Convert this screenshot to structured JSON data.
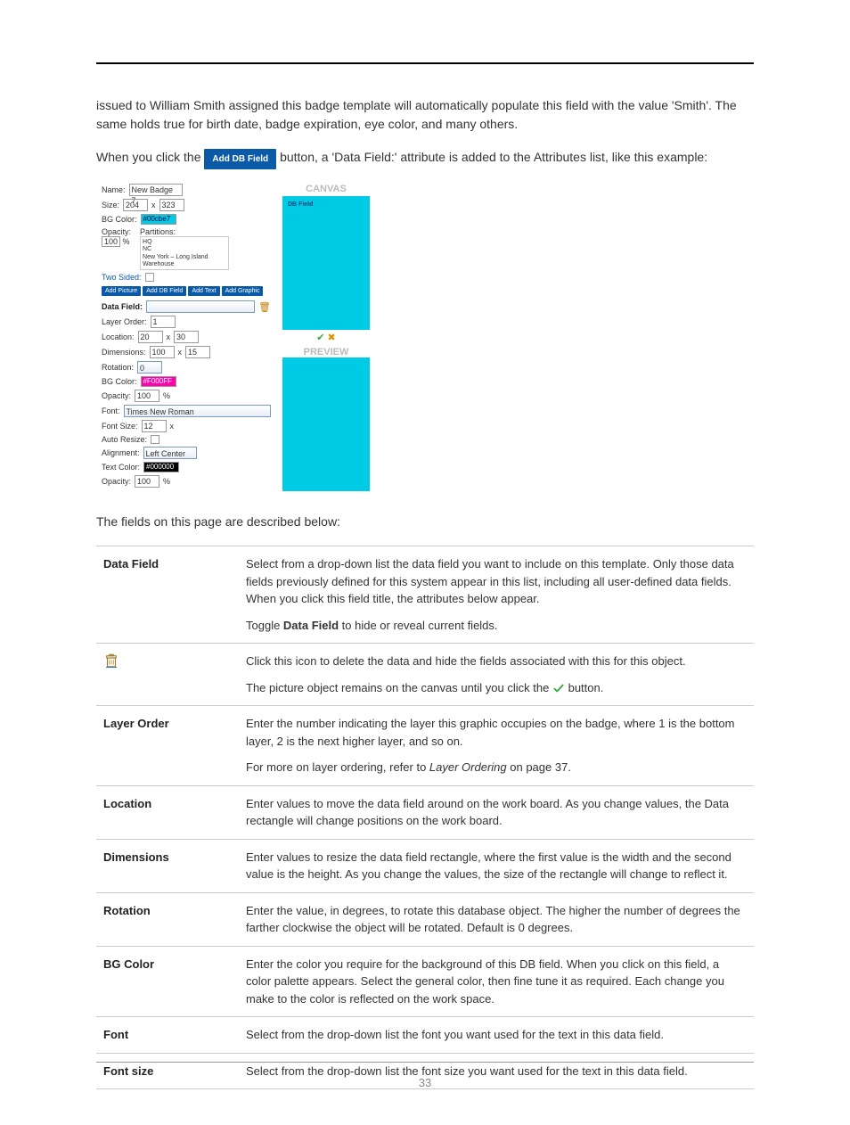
{
  "intro": {
    "p1": "issued to William Smith assigned this badge template will automatically populate this field with the value 'Smith'. The same holds true for birth date, badge expiration, eye color, and many others.",
    "p2a": "When you click the ",
    "p2btn": "Add DB Field",
    "p2b": " button, a 'Data Field:' attribute is added to the Attributes list, like this example:"
  },
  "figure": {
    "name_label": "Name:",
    "name_value": "New Badge 7",
    "size_label": "Size:",
    "size1": "204",
    "size2": "323",
    "bgcolor_label": "BG Color:",
    "bgcolor_value": "#00cbe7",
    "opacity_label": "Opacity:",
    "opacity_value": "100",
    "pct": "%",
    "partitions_label": "Partitions:",
    "partitions_items": [
      "HQ",
      "NC",
      "New York – Long Island Warehouse"
    ],
    "twosided": "Two Sided:",
    "buttons": [
      "Add Picture",
      "Add DB Field",
      "Add Text",
      "Add Graphic"
    ],
    "datafield_label": "Data Field:",
    "layer_label": "Layer Order:",
    "layer_value": "1",
    "location_label": "Location:",
    "location_x": "20",
    "location_y": "30",
    "dimensions_label": "Dimensions:",
    "dim_w": "100",
    "dim_h": "15",
    "rotation_label": "Rotation:",
    "rotation_value": "0",
    "bg2_label": "BG Color:",
    "bg2_value": "#F000FF",
    "opacity2_label": "Opacity:",
    "opacity2_value": "100",
    "font_label": "Font:",
    "font_value": "Times New Roman",
    "fontsize_label": "Font Size:",
    "fontsize_value": "12",
    "autoresize_label": "Auto Resize:",
    "alignment_label": "Alignment:",
    "alignment_value": "Left Center",
    "textcolor_label": "Text Color:",
    "textcolor_value": "#000000",
    "opacity3_label": "Opacity:",
    "opacity3_value": "100",
    "canvas_label": "CANVAS",
    "canvas_dbfield": "DB Field",
    "preview_label": "PREVIEW"
  },
  "midtext": "The fields on this page are described below:",
  "table": {
    "row1": {
      "label": "Data Field",
      "p1a": "Select from a drop-down list the data field you want to include on this template. Only those data fields previously defined for this system appear in this list, including all user-defined data fields. When you click this field title, the attributes below appear.",
      "p2a": "Toggle ",
      "p2b": "Data Field",
      "p2c": " to hide or reveal current fields."
    },
    "row2": {
      "icon": "trash-icon",
      "p1": "Click this icon to delete the data and hide the fields associated with this for this object.",
      "p2a": "The picture object remains on the canvas until you click the ",
      "p2b": " button."
    },
    "row3": {
      "label": "Layer Order",
      "p1": "Enter the number indicating the layer this graphic occupies on the badge, where 1 is the bottom layer, 2 is the next higher layer, and so on.",
      "p2a": "For more on layer ordering, refer to ",
      "p2b": "Layer Ordering",
      "p2c": " on page 37."
    },
    "row4": {
      "label": "Location",
      "p1": "Enter values to move the data field around on the work board. As you change values, the Data rectangle will change positions on the work board."
    },
    "row5": {
      "label": "Dimensions",
      "p1": "Enter values to resize the data field rectangle, where the first value is the width and the second value is the height. As you change the values, the size of the rectangle will change to reflect it."
    },
    "row6": {
      "label": "Rotation",
      "p1": "Enter the value, in degrees, to rotate this database object. The higher the number of degrees the farther clockwise the object will be rotated. Default is 0 degrees."
    },
    "row7": {
      "label": "BG Color",
      "p1": "Enter the color you require for the background of this DB field. When you click on this field, a color palette appears. Select the general color, then fine tune it as required. Each change you make to the color is reflected on the work space."
    },
    "row8": {
      "label": "Font",
      "p1": "Select from the drop-down list the font you want used for the text in this data field."
    },
    "row9": {
      "label": "Font size",
      "p1": "Select from the drop-down list the font size you want used for the text in this data field."
    }
  },
  "page_number": "33"
}
